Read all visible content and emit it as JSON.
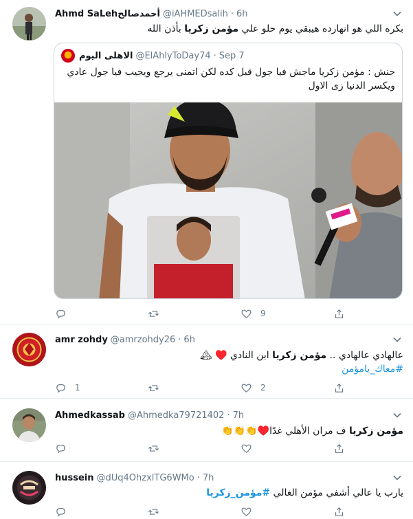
{
  "tweets": [
    {
      "name": "Ahmd SaLehأحمدصالح",
      "handle": "@iAHMEDsalih",
      "dot": "·",
      "time": "6h",
      "text_pre": "بكره اللي هو انهارده هيبقي يوم حلو علي ",
      "text_bold": "مؤمن زكريا",
      "text_post": " بأذن الله",
      "quote": {
        "name": "الاهلى اليوم",
        "handle": "@ElAhlyToDay74",
        "dot": "·",
        "time": "Sep 7",
        "text": "جنش : مؤمن زكريا ماجش فيا جول قبل كده لكن اتمنى يرجع ويجيب فيا جول عادي ويكسر الدنيا زى الاول",
        "image_alt": "Photo of a bearded man in a white t-shirt and cap being interviewed with a microphone"
      },
      "replies": "",
      "retweets": "",
      "likes": "9"
    },
    {
      "name": "amr zohdy",
      "handle": "@amrzohdy26",
      "dot": "·",
      "time": "6h",
      "text_pre": "عالهادي عالهادي .. ",
      "text_bold": "مؤمن زكريا",
      "text_post": " ابن النادي ♥️ 🏔",
      "hashtag": "#معاك_يامؤمن",
      "replies": "1",
      "retweets": "",
      "likes": "2"
    },
    {
      "name": "Ahmedkassab",
      "handle": "@Ahmedka79721402",
      "dot": "·",
      "time": "7h",
      "text_pre": "",
      "text_bold": "مؤمن زكريا",
      "text_post": " ف مران الأهلي غدًا♥️👏👏👏",
      "replies": "",
      "retweets": "",
      "likes": ""
    },
    {
      "name": "hussein",
      "handle": "@dUq4OhzxlTG6WMo",
      "dot": "·",
      "time": "7h",
      "text_pre": "يارب يا عالي أشفي مؤمن الغالي ",
      "hashtag": "#مؤمن_زكريا",
      "replies": "",
      "retweets": "",
      "likes": ""
    }
  ],
  "colors": {
    "text": "#14171a",
    "secondary": "#657786",
    "link": "#1b95e0",
    "border": "#e6ecf0"
  }
}
